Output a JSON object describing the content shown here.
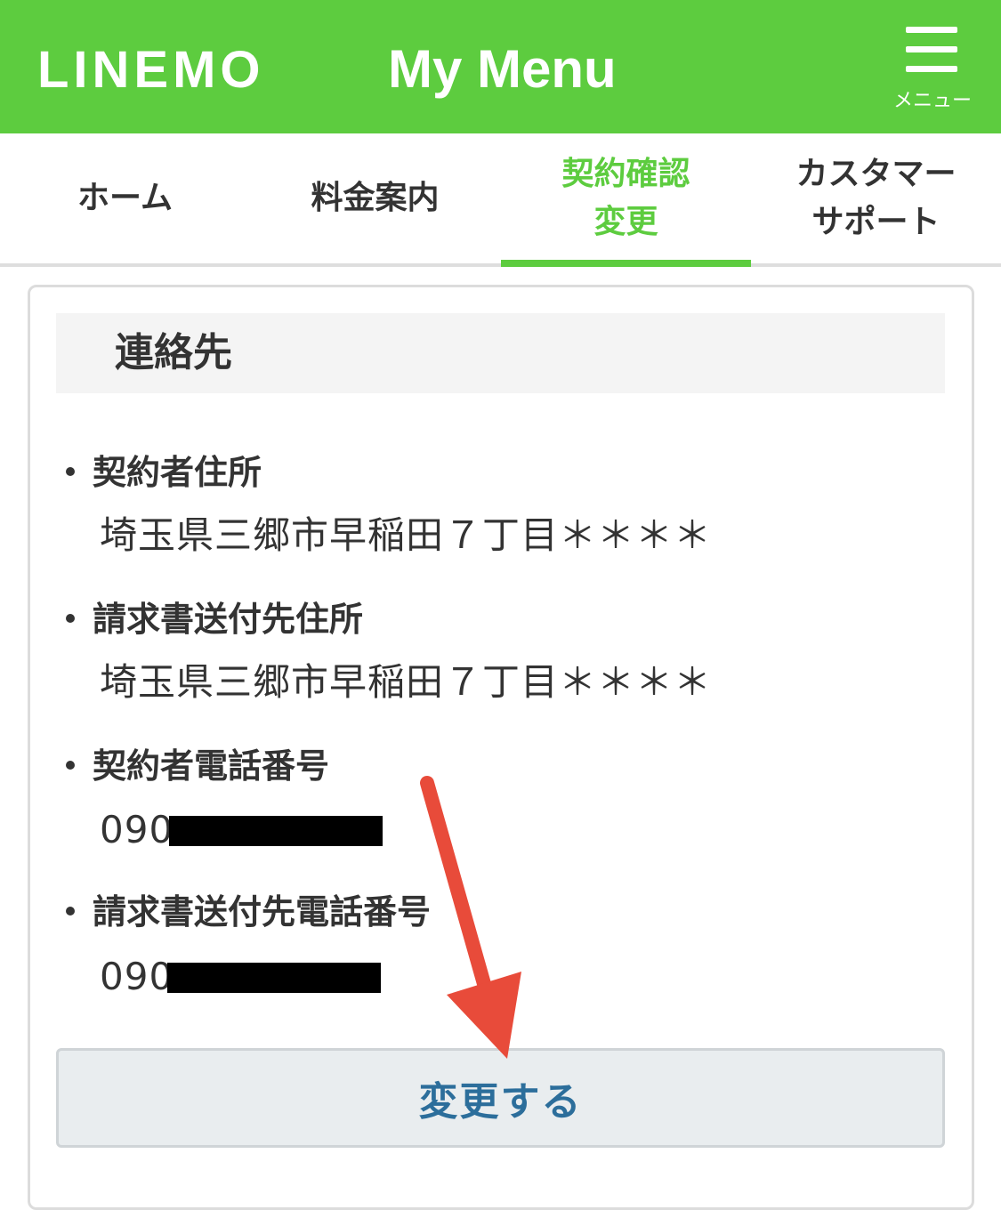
{
  "header": {
    "logo": "LINEMO",
    "title": "My Menu",
    "menu_label": "メニュー"
  },
  "tabs": [
    {
      "label": "ホーム",
      "active": false
    },
    {
      "label": "料金案内",
      "active": false
    },
    {
      "label": "契約確認\n変更",
      "active": true
    },
    {
      "label": "カスタマー\nサポート",
      "active": false
    }
  ],
  "section": {
    "title": "連絡先",
    "items": [
      {
        "label": "契約者住所",
        "value": "埼玉県三郷市早稲田７丁目＊＊＊＊"
      },
      {
        "label": "請求書送付先住所",
        "value": "埼玉県三郷市早稲田７丁目＊＊＊＊"
      },
      {
        "label": "契約者電話番号",
        "value": "090"
      },
      {
        "label": "請求書送付先電話番号",
        "value": "090"
      }
    ]
  },
  "button": {
    "change_label": "変更する"
  },
  "colors": {
    "brand_green": "#5dcc3f",
    "button_text": "#2c6e9b",
    "annotation_arrow": "#e84b3a"
  }
}
